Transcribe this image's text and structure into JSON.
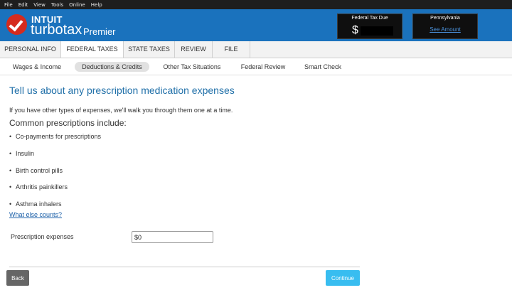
{
  "menu": [
    "File",
    "Edit",
    "View",
    "Tools",
    "Online",
    "Help"
  ],
  "brand": {
    "intuit": "INTUIT",
    "product": "turbotax",
    "edition": "Premier"
  },
  "federal_box": {
    "title": "Federal Tax Due",
    "value": "$"
  },
  "state_box": {
    "title": "Pennsylvania",
    "link": "See Amount"
  },
  "tabs": [
    "PERSONAL INFO",
    "FEDERAL TAXES",
    "STATE TAXES",
    "REVIEW",
    "FILE"
  ],
  "active_tab": "FEDERAL TAXES",
  "subtabs": [
    "Wages & Income",
    "Deductions & Credits",
    "Other Tax Situations",
    "Federal Review",
    "Smart Check"
  ],
  "active_subtab": "Deductions & Credits",
  "page": {
    "heading": "Tell us about any prescription medication expenses",
    "intro": "If you have other types of expenses, we'll walk you through them one at a time.",
    "common_heading": "Common prescriptions include:",
    "bullets": [
      "Co-payments for prescriptions",
      "Insulin",
      "Birth control pills",
      "Arthritis painkillers",
      "Asthma inhalers"
    ],
    "link": "What else counts?",
    "field_label": "Prescription expenses",
    "field_value": "$0"
  },
  "buttons": {
    "back": "Back",
    "continue": "Continue"
  },
  "colors": {
    "brand_blue": "#1a72bd",
    "logo_red": "#d52b1e",
    "heading_blue": "#1f6fa8",
    "continue_blue": "#38bdf0"
  }
}
